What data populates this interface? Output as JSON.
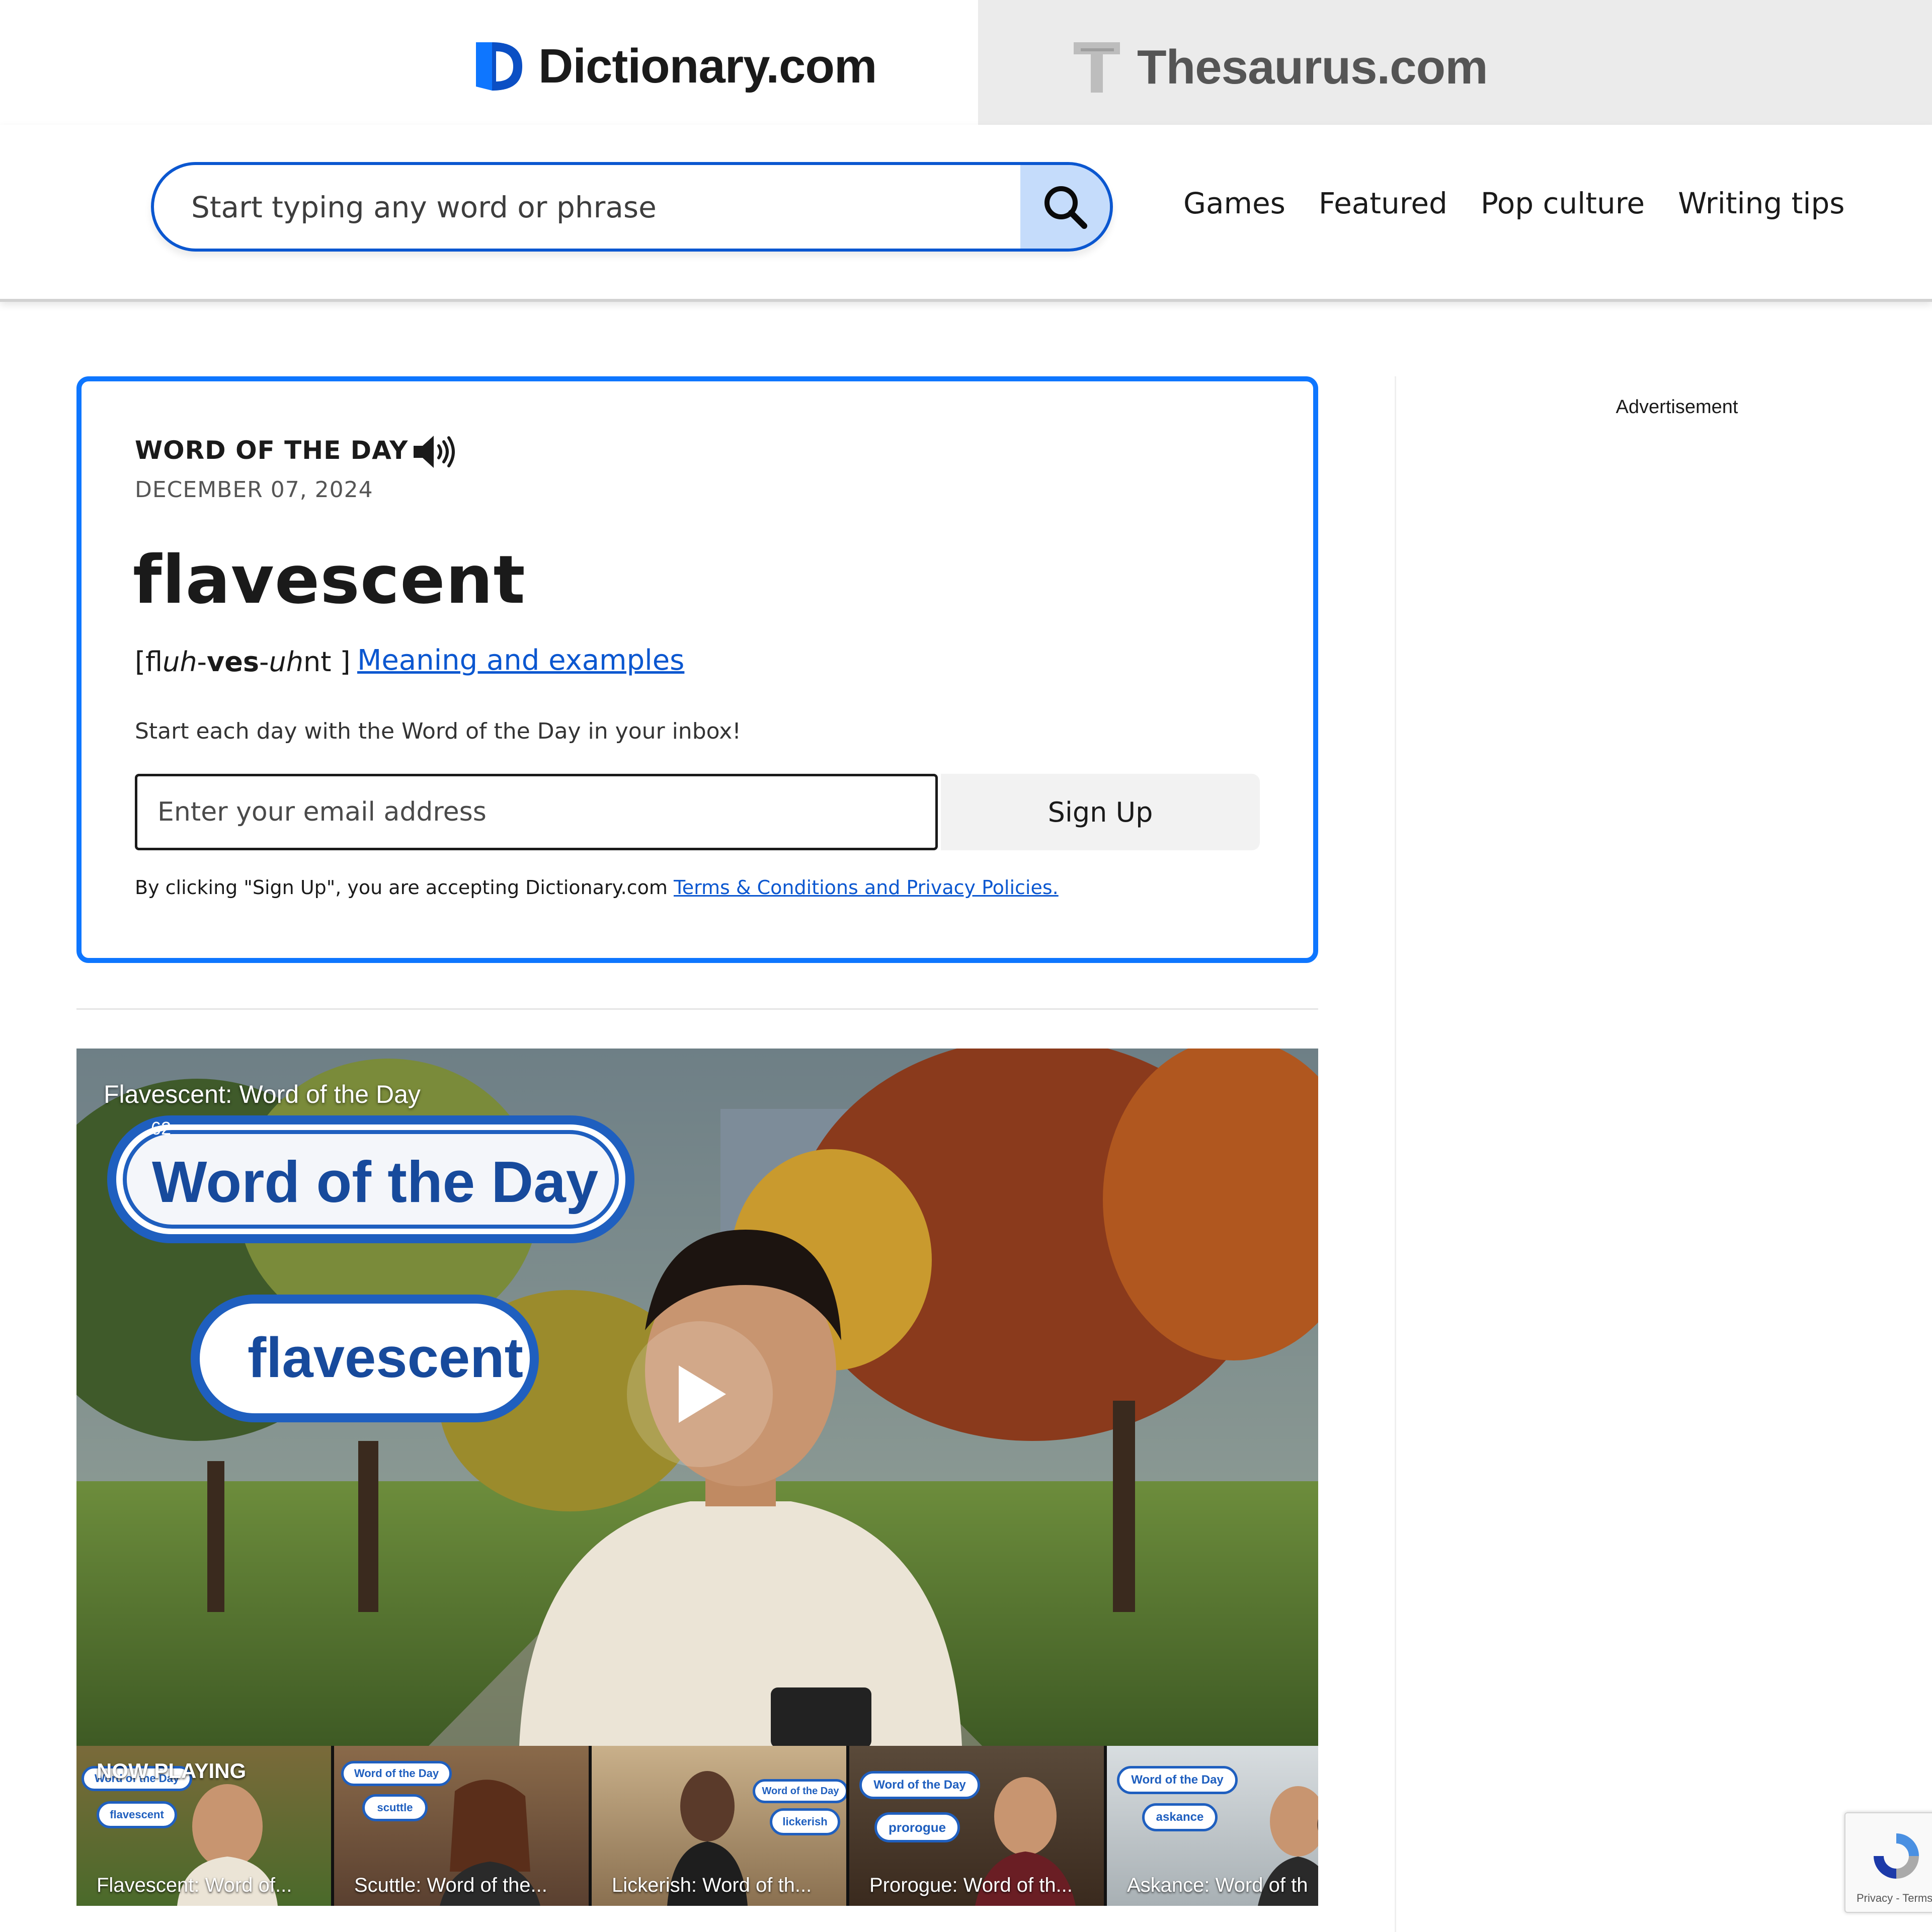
{
  "brands": {
    "dictionary": "Dictionary.com",
    "thesaurus": "Thesaurus.com"
  },
  "search": {
    "placeholder": "Start typing any word or phrase",
    "icon": "search-icon"
  },
  "nav": [
    "Games",
    "Featured",
    "Pop culture",
    "Writing tips"
  ],
  "wotd": {
    "heading": "WORD OF THE DAY",
    "date": "DECEMBER 07, 2024",
    "word": "flavescent",
    "pron_open": "[",
    "pron_p1": "fl",
    "pron_p2": "uh",
    "pron_p3": "-",
    "pron_p4": "ves",
    "pron_p5": "-",
    "pron_p6": "uh",
    "pron_p7": "nt",
    "pron_close": " ]",
    "meaning_link": "Meaning and examples",
    "inbox_text": "Start each day with the Word of the Day in your inbox!",
    "email_placeholder": "Enter your email address",
    "signup_label": "Sign Up",
    "terms_text": "By clicking \"Sign Up\", you are accepting Dictionary.com ",
    "terms_link": "Terms & Conditions and Privacy Policies."
  },
  "sidebar": {
    "ad_label": "Advertisement"
  },
  "video": {
    "title": "Flavescent: Word of the Day",
    "count": "62",
    "overlay_badge": "Word of the Day",
    "overlay_word": "flavescent"
  },
  "playlist": {
    "now_playing": "NOW PLAYING",
    "items": [
      {
        "label": "Flavescent: Word of...",
        "badge": "Word of the Day",
        "word": "flavescent"
      },
      {
        "label": "Scuttle: Word of the...",
        "badge": "Word of the Day",
        "word": "scuttle"
      },
      {
        "label": "Lickerish: Word of th...",
        "badge": "Word of the Day",
        "word": "lickerish"
      },
      {
        "label": "Prorogue: Word of th...",
        "badge": "Word of the Day",
        "word": "prorogue"
      },
      {
        "label": "Askance: Word of th",
        "badge": "Word of the Day",
        "word": "askance"
      }
    ]
  },
  "recaptcha": {
    "text": "Privacy - Terms"
  },
  "colors": {
    "accent_blue": "#0e76ff",
    "link_blue": "#0b57d0",
    "search_button_bg": "#c5dcfb",
    "thesaurus_tab_bg": "#ebebeb"
  }
}
